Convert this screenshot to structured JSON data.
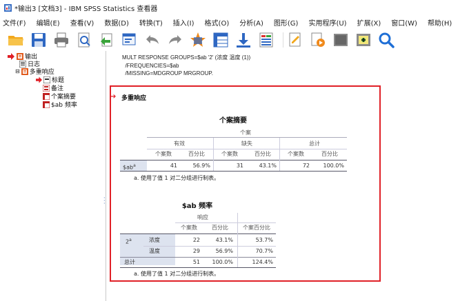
{
  "window": {
    "title": "*输出3 [文档3] - IBM SPSS Statistics 查看器"
  },
  "menubar": {
    "items": [
      "文件(F)",
      "编辑(E)",
      "查看(V)",
      "数据(D)",
      "转换(T)",
      "插入(I)",
      "格式(O)",
      "分析(A)",
      "图形(G)",
      "实用程序(U)",
      "扩展(X)",
      "窗口(W)",
      "帮助(H)"
    ]
  },
  "toolbar": {
    "icons": [
      "open-folder-icon",
      "save-icon",
      "print-icon",
      "print-preview-icon",
      "export-icon",
      "recall-dialog-icon",
      "undo-icon",
      "redo-icon",
      "goto-data-icon",
      "goto-case-icon",
      "goto-variable-icon",
      "variables-icon",
      "create-title-icon",
      "designate-window-icon",
      "hide-icon",
      "show-icon",
      "find-icon"
    ]
  },
  "nav_tree": {
    "root": "输出",
    "items": [
      {
        "label": "日志",
        "level": 2
      },
      {
        "label": "多重响应",
        "level": 1
      },
      {
        "label": "标题",
        "level": 3
      },
      {
        "label": "备注",
        "level": 3
      },
      {
        "label": "个案摘要",
        "level": 3
      },
      {
        "label": "$ab 频率",
        "level": 3
      }
    ]
  },
  "syntax": {
    "lines": [
      "MULT RESPONSE GROUPS=$ab '2' (浓度 温度 (1))",
      "  /FREQUENCIES=$ab",
      "  /MISSING=MDGROUP MRGROUP."
    ]
  },
  "output": {
    "section_title": "多重响应",
    "case_summary": {
      "title": "个案摘要",
      "top_header": "个案",
      "groups": [
        "有效",
        "缺失",
        "总计"
      ],
      "subheaders": [
        "个案数",
        "百分比",
        "个案数",
        "百分比",
        "个案数",
        "百分比"
      ],
      "row_label": "$ab",
      "row_sup": "a",
      "values": [
        "41",
        "56.9%",
        "31",
        "43.1%",
        "72",
        "100.0%"
      ],
      "footnote": "a. 使用了值 1 对二分组进行制表。"
    },
    "frequency": {
      "title": "$ab 频率",
      "top_header": "响应",
      "headers": [
        "个案数",
        "百分比",
        "个案百分比"
      ],
      "group_label": "2",
      "group_sup": "a",
      "rows": [
        {
          "label": "浓度",
          "n": "22",
          "pct": "43.1%",
          "case_pct": "53.7%"
        },
        {
          "label": "温度",
          "n": "29",
          "pct": "56.9%",
          "case_pct": "70.7%"
        }
      ],
      "total": {
        "label": "总计",
        "n": "51",
        "pct": "100.0%",
        "case_pct": "124.4%"
      },
      "footnote": "a. 使用了值 1 对二分组进行制表。"
    }
  },
  "colors": {
    "selection": "#e01f26",
    "header_shade": "#dde3ef"
  }
}
